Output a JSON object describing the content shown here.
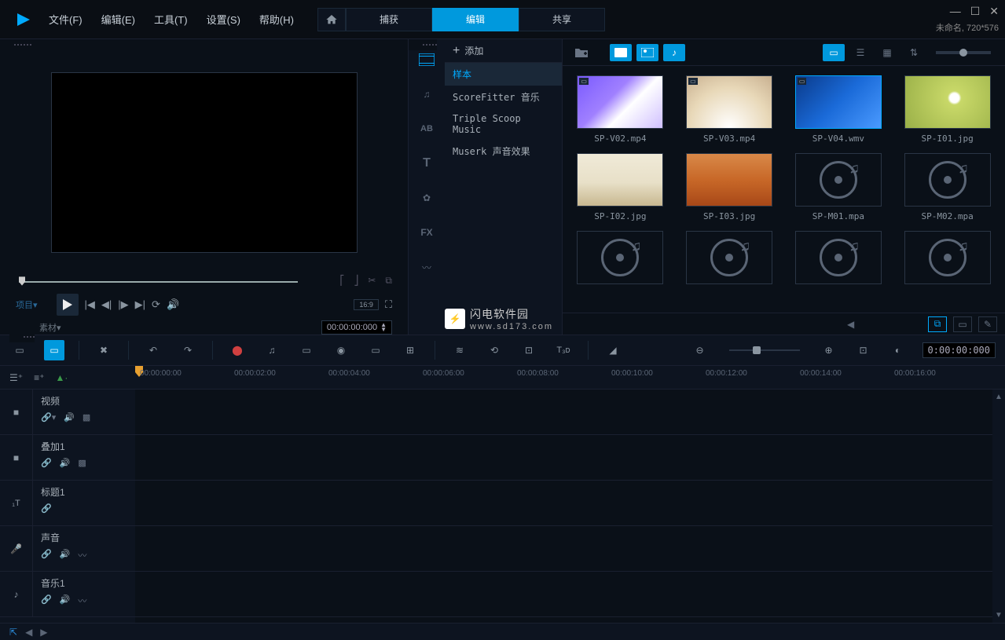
{
  "menu": {
    "file": "文件(F)",
    "edit": "编辑(E)",
    "tools": "工具(T)",
    "settings": "设置(S)",
    "help": "帮助(H)"
  },
  "tabs": {
    "capture": "捕获",
    "edit": "编辑",
    "share": "共享"
  },
  "project": {
    "name": "未命名,",
    "res": "720*576"
  },
  "preview": {
    "label_project": "项目",
    "label_clip": "素材",
    "aspect": "16:9",
    "timecode": "00:00:00:000"
  },
  "library": {
    "add": "添加",
    "tree": {
      "sample": "样本",
      "scorefitter": "ScoreFitter 音乐",
      "triplescoop": "Triple Scoop Music",
      "muserk": "Muserk 声音效果"
    },
    "items": [
      {
        "name": "SP-V02.mp4",
        "type": "video",
        "bg": "linear-gradient(135deg,#7a5aff 0%,#a080ff 40%,#fff 60%,#d0c0ff 100%)"
      },
      {
        "name": "SP-V03.mp4",
        "type": "video",
        "bg": "radial-gradient(circle at 50% 100%,#fff 0%,#e8d8b8 60%,#c8b090 100%)"
      },
      {
        "name": "SP-V04.wmv",
        "type": "video",
        "bg": "linear-gradient(135deg,#0a3a8a 0%,#1a6ad8 50%,#4a9aff 100%)",
        "selected": true
      },
      {
        "name": "SP-I01.jpg",
        "type": "image",
        "bg": "radial-gradient(circle at 58% 42%,#fff 0%,#fff 8%,#c8d868 12%,#9ab048 100%)"
      },
      {
        "name": "SP-I02.jpg",
        "type": "image",
        "bg": "linear-gradient(#f0ead8 0%,#e8e0c8 55%,#c8b890 100%)"
      },
      {
        "name": "SP-I03.jpg",
        "type": "image",
        "bg": "linear-gradient(#d88848 0%,#c86828 50%,#a84818 100%)"
      },
      {
        "name": "SP-M01.mpa",
        "type": "audio"
      },
      {
        "name": "SP-M02.mpa",
        "type": "audio"
      },
      {
        "name": "",
        "type": "audio"
      },
      {
        "name": "",
        "type": "audio"
      },
      {
        "name": "",
        "type": "audio"
      },
      {
        "name": "",
        "type": "audio"
      }
    ],
    "browse": "浏览"
  },
  "ruler": [
    "00:00:00:00",
    "00:00:02:00",
    "00:00:04:00",
    "00:00:06:00",
    "00:00:08:00",
    "00:00:10:00",
    "00:00:12:00",
    "00:00:14:00",
    "00:00:16:00"
  ],
  "tracks": {
    "video": "视频",
    "overlay": "叠加1",
    "title": "标题1",
    "voice": "声音",
    "music": "音乐1"
  },
  "tl_timecode": "0:00:00:000",
  "watermark": {
    "title": "闪电软件园",
    "url": "www.sd173.com"
  }
}
